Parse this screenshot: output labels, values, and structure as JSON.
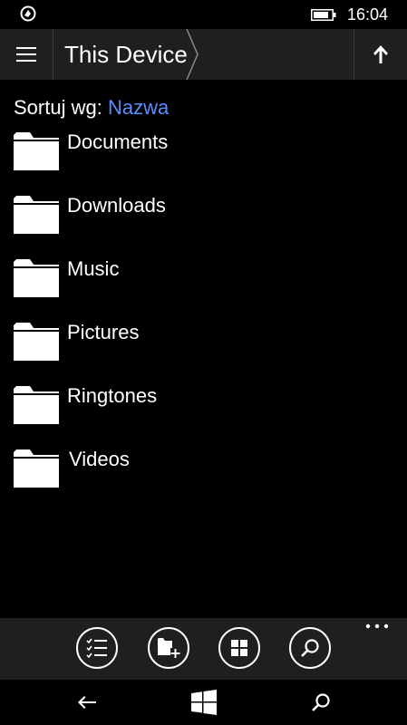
{
  "status_bar": {
    "time": "16:04",
    "app_icon": "notification-app-icon",
    "battery_icon": "battery-icon"
  },
  "header": {
    "title": "This Device",
    "menu_icon": "hamburger-menu-icon",
    "up_icon": "arrow-up-icon"
  },
  "sort": {
    "label": "Sortuj wg:",
    "value": "Nazwa"
  },
  "folders": [
    {
      "name": "Documents",
      "icon": "folder-icon"
    },
    {
      "name": "Downloads",
      "icon": "folder-icon"
    },
    {
      "name": "Music",
      "icon": "folder-icon"
    },
    {
      "name": "Pictures",
      "icon": "folder-icon"
    },
    {
      "name": "Ringtones",
      "icon": "folder-icon"
    },
    {
      "name": "Videos",
      "icon": "folder-icon"
    }
  ],
  "app_bar": {
    "buttons": [
      {
        "icon": "select-list-icon"
      },
      {
        "icon": "new-folder-icon"
      },
      {
        "icon": "tiles-view-icon"
      },
      {
        "icon": "search-icon"
      }
    ],
    "more_icon": "more-ellipsis-icon"
  },
  "nav_bar": {
    "back_icon": "back-arrow-icon",
    "start_icon": "windows-start-icon",
    "search_icon": "search-icon"
  },
  "colors": {
    "background": "#000000",
    "bar": "#1f1f1f",
    "accent": "#5b8cff",
    "text": "#ffffff"
  }
}
